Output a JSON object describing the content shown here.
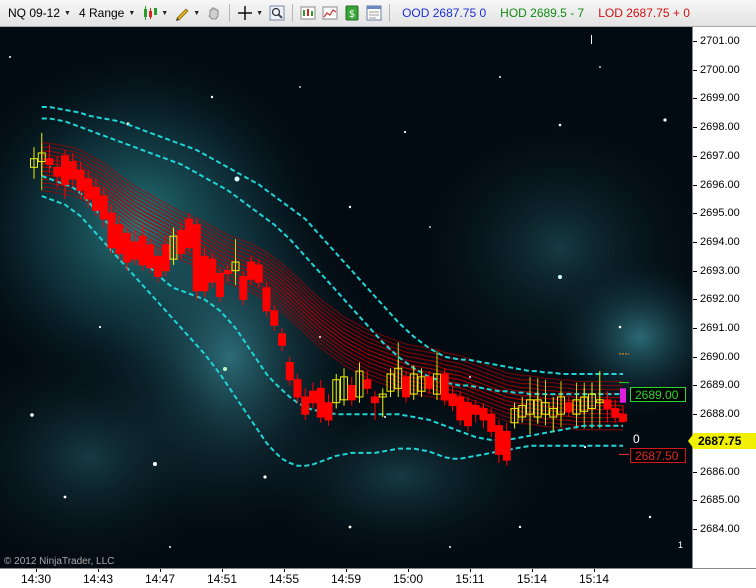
{
  "toolbar": {
    "instrument": "NQ 09-12",
    "bar_type": "4 Range",
    "stat_ood": "OOD  2687.75  0",
    "stat_hod": "HOD  2689.5 - 7",
    "stat_lod": "LOD  2687.75 + 0",
    "icons": [
      "chart-style-icon",
      "draw-pencil-icon",
      "hand-pan-icon",
      "crosshair-icon",
      "magnifier-icon",
      "data-box-icon",
      "indicators-icon",
      "strategies-icon",
      "properties-icon"
    ]
  },
  "colors": {
    "up_bar": "#f0f000",
    "down_bar": "#ff0000",
    "ribbon": "#b00000",
    "envelope": "#1fd6d6",
    "hod": "#2bd82b",
    "lod": "#e02a2a",
    "last_price": "#f0f000"
  },
  "price_axis": {
    "min": 2684.0,
    "max": 2701.0,
    "ticks": [
      "2701.00",
      "2700.00",
      "2699.00",
      "2698.00",
      "2697.00",
      "2696.00",
      "2695.00",
      "2694.00",
      "2693.00",
      "2692.00",
      "2691.00",
      "2690.00",
      "2689.00",
      "2688.00",
      "2687.00",
      "2686.00",
      "2685.00",
      "2684.00"
    ],
    "last_price": "2687.75"
  },
  "labels": {
    "hod_price": "2689.00",
    "lod_price": "2687.50",
    "zero": "0",
    "copyright": "© 2012 NinjaTrader, LLC",
    "page": "1"
  },
  "time_axis": {
    "ticks": [
      {
        "label": "14:30",
        "bar": 1
      },
      {
        "label": "14:43",
        "bar": 9
      },
      {
        "label": "14:47",
        "bar": 17
      },
      {
        "label": "14:51",
        "bar": 25
      },
      {
        "label": "14:55",
        "bar": 33
      },
      {
        "label": "14:59",
        "bar": 41
      },
      {
        "label": "15:00",
        "bar": 49
      },
      {
        "label": "15:11",
        "bar": 57
      },
      {
        "label": "15:14",
        "bar": 65
      },
      {
        "label": "15:14",
        "bar": 73
      }
    ]
  },
  "chart_data": {
    "type": "candlestick",
    "bars": [
      {
        "o": 2696.6,
        "h": 2697.3,
        "l": 2696.2,
        "c": 2696.9
      },
      {
        "o": 2696.8,
        "h": 2697.8,
        "l": 2696.3,
        "c": 2697.1
      },
      {
        "o": 2696.9,
        "h": 2697.4,
        "l": 2696.4,
        "c": 2696.7
      },
      {
        "o": 2696.6,
        "h": 2697.0,
        "l": 2695.9,
        "c": 2696.3
      },
      {
        "o": 2697.0,
        "h": 2697.2,
        "l": 2695.5,
        "c": 2696.0
      },
      {
        "o": 2696.8,
        "h": 2697.1,
        "l": 2695.9,
        "c": 2696.2
      },
      {
        "o": 2696.5,
        "h": 2696.8,
        "l": 2695.5,
        "c": 2695.8
      },
      {
        "o": 2696.2,
        "h": 2696.5,
        "l": 2695.2,
        "c": 2695.5
      },
      {
        "o": 2695.9,
        "h": 2696.2,
        "l": 2694.9,
        "c": 2695.1
      },
      {
        "o": 2695.6,
        "h": 2695.9,
        "l": 2694.5,
        "c": 2694.8
      },
      {
        "o": 2695.0,
        "h": 2695.3,
        "l": 2693.6,
        "c": 2693.8
      },
      {
        "o": 2694.6,
        "h": 2694.9,
        "l": 2693.4,
        "c": 2693.6
      },
      {
        "o": 2694.3,
        "h": 2694.5,
        "l": 2693.0,
        "c": 2693.3
      },
      {
        "o": 2694.0,
        "h": 2694.4,
        "l": 2693.2,
        "c": 2693.4
      },
      {
        "o": 2694.2,
        "h": 2694.6,
        "l": 2693.0,
        "c": 2693.2
      },
      {
        "o": 2693.9,
        "h": 2694.1,
        "l": 2692.9,
        "c": 2693.1
      },
      {
        "o": 2693.5,
        "h": 2693.8,
        "l": 2692.6,
        "c": 2692.8
      },
      {
        "o": 2693.9,
        "h": 2694.2,
        "l": 2692.8,
        "c": 2693.0
      },
      {
        "o": 2693.4,
        "h": 2694.5,
        "l": 2693.2,
        "c": 2694.2
      },
      {
        "o": 2694.4,
        "h": 2694.7,
        "l": 2693.4,
        "c": 2693.6
      },
      {
        "o": 2694.8,
        "h": 2695.0,
        "l": 2693.6,
        "c": 2693.8
      },
      {
        "o": 2694.6,
        "h": 2694.8,
        "l": 2692.0,
        "c": 2692.3
      },
      {
        "o": 2693.5,
        "h": 2693.8,
        "l": 2692.1,
        "c": 2692.3
      },
      {
        "o": 2693.4,
        "h": 2693.6,
        "l": 2692.4,
        "c": 2692.6
      },
      {
        "o": 2692.9,
        "h": 2693.1,
        "l": 2691.9,
        "c": 2692.1
      },
      {
        "o": 2693.0,
        "h": 2693.2,
        "l": 2692.6,
        "c": 2692.9
      },
      {
        "o": 2693.0,
        "h": 2693.4,
        "l": 2692.8,
        "c": 2693.3
      },
      {
        "o": 2692.8,
        "h": 2693.0,
        "l": 2691.8,
        "c": 2692.0
      },
      {
        "o": 2693.3,
        "h": 2693.5,
        "l": 2692.5,
        "c": 2692.7
      },
      {
        "o": 2693.2,
        "h": 2693.4,
        "l": 2692.4,
        "c": 2692.6
      },
      {
        "o": 2692.4,
        "h": 2692.6,
        "l": 2691.4,
        "c": 2691.6
      },
      {
        "o": 2691.6,
        "h": 2691.8,
        "l": 2690.9,
        "c": 2691.1
      },
      {
        "o": 2690.8,
        "h": 2691.0,
        "l": 2690.2,
        "c": 2690.4
      },
      {
        "o": 2689.8,
        "h": 2690.0,
        "l": 2689.0,
        "c": 2689.2
      },
      {
        "o": 2689.2,
        "h": 2689.4,
        "l": 2688.4,
        "c": 2688.6
      },
      {
        "o": 2688.6,
        "h": 2688.9,
        "l": 2687.8,
        "c": 2688.0
      },
      {
        "o": 2688.8,
        "h": 2689.1,
        "l": 2688.2,
        "c": 2688.4
      },
      {
        "o": 2688.9,
        "h": 2689.2,
        "l": 2687.7,
        "c": 2687.9
      },
      {
        "o": 2688.4,
        "h": 2688.7,
        "l": 2687.6,
        "c": 2687.8
      },
      {
        "o": 2688.4,
        "h": 2689.4,
        "l": 2688.2,
        "c": 2689.2
      },
      {
        "o": 2688.5,
        "h": 2689.6,
        "l": 2688.3,
        "c": 2689.3
      },
      {
        "o": 2689.0,
        "h": 2689.3,
        "l": 2688.3,
        "c": 2688.5
      },
      {
        "o": 2688.6,
        "h": 2689.8,
        "l": 2688.4,
        "c": 2689.5
      },
      {
        "o": 2689.2,
        "h": 2689.5,
        "l": 2688.7,
        "c": 2688.9
      },
      {
        "o": 2688.6,
        "h": 2688.8,
        "l": 2687.8,
        "c": 2688.4
      },
      {
        "o": 2688.6,
        "h": 2688.9,
        "l": 2687.9,
        "c": 2688.7
      },
      {
        "o": 2688.8,
        "h": 2689.6,
        "l": 2688.6,
        "c": 2689.4
      },
      {
        "o": 2688.9,
        "h": 2689.9,
        "l": 2688.6,
        "c": 2689.6
      },
      {
        "o": 2689.3,
        "h": 2689.5,
        "l": 2688.4,
        "c": 2688.6
      },
      {
        "o": 2688.7,
        "h": 2689.7,
        "l": 2688.5,
        "c": 2689.4
      },
      {
        "o": 2688.8,
        "h": 2689.6,
        "l": 2688.6,
        "c": 2689.3
      },
      {
        "o": 2689.3,
        "h": 2689.5,
        "l": 2688.7,
        "c": 2688.9
      },
      {
        "o": 2688.7,
        "h": 2689.7,
        "l": 2688.5,
        "c": 2689.4
      },
      {
        "o": 2689.4,
        "h": 2689.6,
        "l": 2688.3,
        "c": 2688.5
      },
      {
        "o": 2688.7,
        "h": 2689.0,
        "l": 2688.1,
        "c": 2688.3
      },
      {
        "o": 2688.6,
        "h": 2688.8,
        "l": 2687.6,
        "c": 2687.8
      },
      {
        "o": 2688.4,
        "h": 2688.6,
        "l": 2687.4,
        "c": 2687.6
      },
      {
        "o": 2688.3,
        "h": 2688.5,
        "l": 2687.7,
        "c": 2688.0
      },
      {
        "o": 2688.2,
        "h": 2688.4,
        "l": 2687.5,
        "c": 2687.8
      },
      {
        "o": 2688.0,
        "h": 2688.2,
        "l": 2687.2,
        "c": 2687.4
      },
      {
        "o": 2687.6,
        "h": 2687.8,
        "l": 2686.3,
        "c": 2686.6
      },
      {
        "o": 2687.4,
        "h": 2687.7,
        "l": 2686.2,
        "c": 2686.4
      },
      {
        "o": 2687.7,
        "h": 2688.4,
        "l": 2687.5,
        "c": 2688.2
      },
      {
        "o": 2687.9,
        "h": 2688.6,
        "l": 2687.7,
        "c": 2688.3
      },
      {
        "o": 2688.0,
        "h": 2688.7,
        "l": 2687.3,
        "c": 2688.5
      },
      {
        "o": 2687.9,
        "h": 2688.8,
        "l": 2687.7,
        "c": 2688.5
      },
      {
        "o": 2688.0,
        "h": 2688.7,
        "l": 2687.8,
        "c": 2688.4
      },
      {
        "o": 2687.9,
        "h": 2688.6,
        "l": 2687.4,
        "c": 2688.2
      },
      {
        "o": 2688.0,
        "h": 2688.8,
        "l": 2687.8,
        "c": 2688.6
      },
      {
        "o": 2688.4,
        "h": 2688.6,
        "l": 2687.9,
        "c": 2688.1
      },
      {
        "o": 2688.0,
        "h": 2688.7,
        "l": 2687.9,
        "c": 2688.5
      },
      {
        "o": 2688.1,
        "h": 2688.9,
        "l": 2688.0,
        "c": 2688.6
      },
      {
        "o": 2688.2,
        "h": 2689.1,
        "l": 2688.0,
        "c": 2688.7
      },
      {
        "o": 2688.4,
        "h": 2689.5,
        "l": 2688.0,
        "c": 2688.5
      },
      {
        "o": 2688.5,
        "h": 2688.8,
        "l": 2687.7,
        "c": 2688.2
      },
      {
        "o": 2688.2,
        "h": 2688.5,
        "l": 2687.7,
        "c": 2687.9
      },
      {
        "o": 2688.0,
        "h": 2688.3,
        "l": 2687.7,
        "c": 2687.75
      }
    ],
    "ribbon_mid": [
      2696.6,
      2696.6,
      2696.55,
      2696.5,
      2696.45,
      2696.35,
      2696.2,
      2696.05,
      2695.9,
      2695.7,
      2695.5,
      2695.3,
      2695.1,
      2694.95,
      2694.8,
      2694.65,
      2694.5,
      2694.35,
      2694.2,
      2694.1,
      2694.0,
      2693.85,
      2693.7,
      2693.55,
      2693.4,
      2693.3,
      2693.2,
      2693.1,
      2692.95,
      2692.8,
      2692.6,
      2692.4,
      2692.15,
      2691.9,
      2691.65,
      2691.4,
      2691.15,
      2690.95,
      2690.75,
      2690.55,
      2690.4,
      2690.25,
      2690.1,
      2690.0,
      2689.9,
      2689.8,
      2689.7,
      2689.6,
      2689.55,
      2689.5,
      2689.45,
      2689.4,
      2689.3,
      2689.25,
      2689.2,
      2689.1,
      2689.0,
      2688.9,
      2688.8,
      2688.7,
      2688.6,
      2688.55,
      2688.5,
      2688.5,
      2688.45,
      2688.4,
      2688.4,
      2688.35,
      2688.35,
      2688.3,
      2688.3,
      2688.3,
      2688.3,
      2688.3,
      2688.3,
      2688.3
    ],
    "env_upper_outer": [
      2698.7,
      2698.7,
      2698.65,
      2698.6,
      2698.55,
      2698.5,
      2698.4,
      2698.35,
      2698.3,
      2698.25,
      2698.2,
      2698.1,
      2698.0,
      2697.9,
      2697.8,
      2697.7,
      2697.6,
      2697.5,
      2697.4,
      2697.3,
      2697.2,
      2697.05,
      2696.9,
      2696.75,
      2696.6,
      2696.45,
      2696.3,
      2696.15,
      2696.0,
      2695.8,
      2695.6,
      2695.4,
      2695.2,
      2695.0,
      2694.8,
      2694.5,
      2694.2,
      2693.9,
      2693.6,
      2693.3,
      2693.0,
      2692.7,
      2692.4,
      2692.1,
      2691.8,
      2691.5,
      2691.2,
      2690.95,
      2690.7,
      2690.5,
      2690.3,
      2690.15,
      2690.0,
      2689.95,
      2689.9,
      2689.9,
      2689.85,
      2689.8,
      2689.75,
      2689.7,
      2689.65,
      2689.6,
      2689.55,
      2689.5,
      2689.5,
      2689.45,
      2689.45,
      2689.4,
      2689.4,
      2689.4,
      2689.4,
      2689.4,
      2689.4,
      2689.4,
      2689.4,
      2689.4
    ],
    "env_upper_inner": [
      2698.3,
      2698.3,
      2698.25,
      2698.2,
      2698.1,
      2698.0,
      2697.9,
      2697.8,
      2697.7,
      2697.6,
      2697.5,
      2697.4,
      2697.3,
      2697.2,
      2697.1,
      2697.0,
      2696.9,
      2696.8,
      2696.7,
      2696.55,
      2696.4,
      2696.25,
      2696.1,
      2695.95,
      2695.8,
      2695.6,
      2695.4,
      2695.2,
      2695.0,
      2694.8,
      2694.6,
      2694.35,
      2694.1,
      2693.8,
      2693.5,
      2693.2,
      2692.9,
      2692.6,
      2692.3,
      2692.0,
      2691.7,
      2691.4,
      2691.1,
      2690.8,
      2690.5,
      2690.25,
      2690.0,
      2689.8,
      2689.6,
      2689.45,
      2689.3,
      2689.2,
      2689.1,
      2689.05,
      2689.0,
      2689.0,
      2688.95,
      2688.9,
      2688.85,
      2688.8,
      2688.8,
      2688.75,
      2688.75,
      2688.7,
      2688.7,
      2688.7,
      2688.7,
      2688.7,
      2688.7,
      2688.7,
      2688.7,
      2688.7,
      2688.7,
      2688.7,
      2688.7,
      2688.7
    ],
    "env_lower_inner": [
      2696.3,
      2696.2,
      2696.1,
      2696.0,
      2695.9,
      2695.7,
      2695.4,
      2695.1,
      2694.8,
      2694.5,
      2694.2,
      2693.9,
      2693.6,
      2693.35,
      2693.1,
      2692.85,
      2692.6,
      2692.4,
      2692.3,
      2692.2,
      2692.1,
      2692.0,
      2691.8,
      2691.6,
      2691.3,
      2691.0,
      2690.6,
      2690.2,
      2689.8,
      2689.4,
      2689.1,
      2688.85,
      2688.6,
      2688.4,
      2688.25,
      2688.15,
      2688.1,
      2688.05,
      2688.0,
      2688.0,
      2688.0,
      2688.0,
      2688.0,
      2688.0,
      2688.0,
      2688.0,
      2688.0,
      2687.95,
      2687.9,
      2687.85,
      2687.8,
      2687.7,
      2687.6,
      2687.5,
      2687.4,
      2687.3,
      2687.2,
      2687.15,
      2687.1,
      2687.1,
      2687.1,
      2687.15,
      2687.2,
      2687.25,
      2687.3,
      2687.35,
      2687.4,
      2687.45,
      2687.5,
      2687.55,
      2687.6,
      2687.6,
      2687.6,
      2687.6,
      2687.6,
      2687.6
    ],
    "env_lower_outer": [
      2695.6,
      2695.5,
      2695.4,
      2695.3,
      2695.1,
      2694.9,
      2694.6,
      2694.3,
      2694.0,
      2693.7,
      2693.4,
      2693.1,
      2692.8,
      2692.5,
      2692.2,
      2691.9,
      2691.6,
      2691.3,
      2691.0,
      2690.7,
      2690.4,
      2690.1,
      2689.75,
      2689.4,
      2689.0,
      2688.6,
      2688.2,
      2687.8,
      2687.4,
      2687.0,
      2686.7,
      2686.45,
      2686.3,
      2686.2,
      2686.2,
      2686.25,
      2686.35,
      2686.45,
      2686.55,
      2686.6,
      2686.65,
      2686.65,
      2686.65,
      2686.65,
      2686.7,
      2686.75,
      2686.8,
      2686.8,
      2686.8,
      2686.75,
      2686.7,
      2686.6,
      2686.5,
      2686.45,
      2686.45,
      2686.5,
      2686.55,
      2686.6,
      2686.65,
      2686.7,
      2686.75,
      2686.8,
      2686.85,
      2686.9,
      2686.9,
      2686.9,
      2686.9,
      2686.9,
      2686.9,
      2686.9,
      2686.9,
      2686.9,
      2686.9,
      2686.9,
      2686.9,
      2686.9
    ],
    "y_range": [
      2684.0,
      2701.0
    ]
  }
}
